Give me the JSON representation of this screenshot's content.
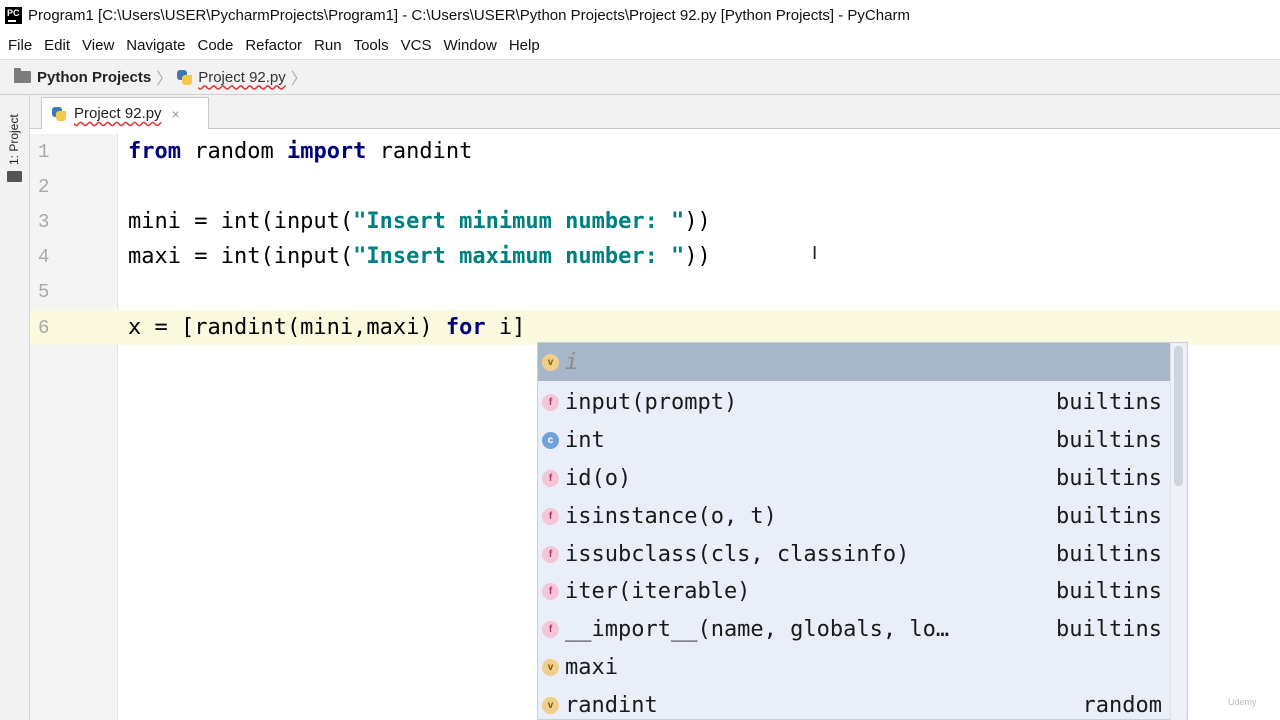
{
  "window": {
    "title": "Program1 [C:\\Users\\USER\\PycharmProjects\\Program1] - C:\\Users\\USER\\Python Projects\\Project 92.py [Python Projects] - PyCharm",
    "app_icon_text": "PC"
  },
  "menu": [
    "File",
    "Edit",
    "View",
    "Navigate",
    "Code",
    "Refactor",
    "Run",
    "Tools",
    "VCS",
    "Window",
    "Help"
  ],
  "breadcrumb": {
    "root": "Python Projects",
    "file": "Project 92.py"
  },
  "toolstrip": {
    "project_label": "1: Project"
  },
  "editor": {
    "tab_label": "Project 92.py",
    "tab_close": "×",
    "lines": [
      {
        "no": "1"
      },
      {
        "no": "2"
      },
      {
        "no": "3"
      },
      {
        "no": "4"
      },
      {
        "no": "5"
      },
      {
        "no": "6"
      }
    ],
    "code": {
      "l1_kw1": "from",
      "l1_mid": " random ",
      "l1_kw2": "import",
      "l1_end": " randint",
      "l3_pre": "mini = int(input(",
      "l3_str": "\"Insert minimum number: \"",
      "l3_post": "))",
      "l4_pre": "maxi = int(input(",
      "l4_str": "\"Insert maximum number: \"",
      "l4_post": "))",
      "l6_pre": "x = [randint(mini,maxi) ",
      "l6_kw": "for",
      "l6_post": " i]"
    }
  },
  "autocomplete": {
    "items": [
      {
        "kind": "v",
        "name": "i",
        "source": ""
      },
      {
        "kind": "f",
        "name": "input(prompt)",
        "source": "builtins"
      },
      {
        "kind": "c",
        "name": "int",
        "source": "builtins"
      },
      {
        "kind": "f",
        "name": "id(o)",
        "source": "builtins"
      },
      {
        "kind": "f",
        "name": "isinstance(o, t)",
        "source": "builtins"
      },
      {
        "kind": "f",
        "name": "issubclass(cls, classinfo)",
        "source": "builtins"
      },
      {
        "kind": "f",
        "name": "iter(iterable)",
        "source": "builtins"
      },
      {
        "kind": "f",
        "name": "__import__(name, globals, lo…",
        "source": "builtins"
      },
      {
        "kind": "v",
        "name": "maxi",
        "source": ""
      },
      {
        "kind": "v",
        "name": "randint",
        "source": "random"
      }
    ]
  },
  "watermark": "Udemy"
}
